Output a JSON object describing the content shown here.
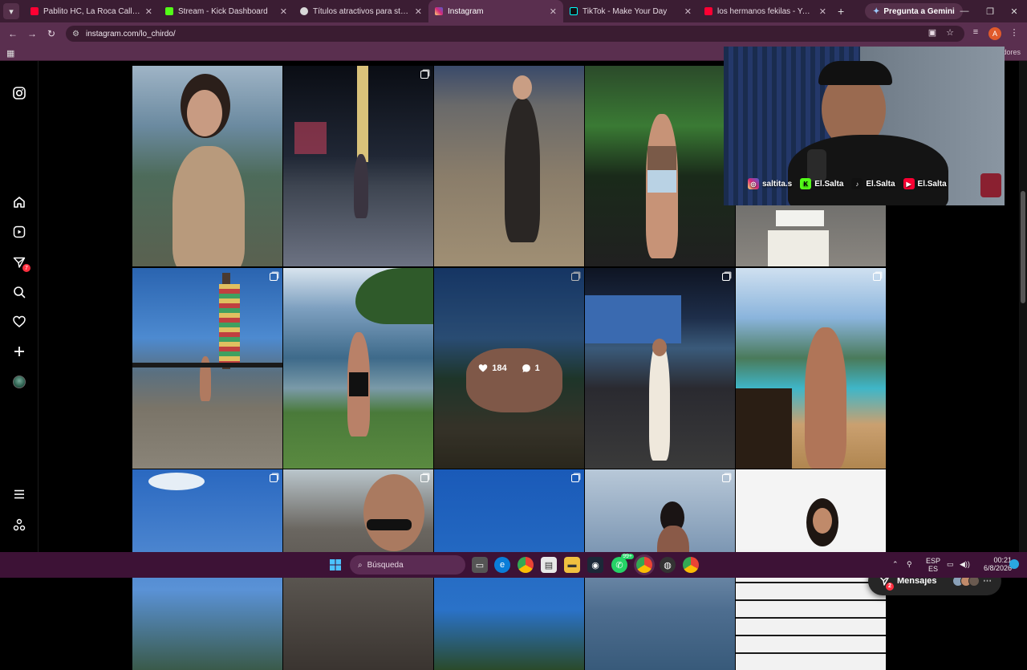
{
  "browser": {
    "tabs": [
      {
        "title": "Pablito HC, La Roca Callejera - ",
        "favicon_color": "#ff0033",
        "active": false
      },
      {
        "title": "Stream - Kick Dashboard",
        "favicon_color": "#53fc18",
        "active": false
      },
      {
        "title": "Títulos atractivos para stream",
        "favicon_color": "#d8d8d8",
        "active": false
      },
      {
        "title": "Instagram",
        "favicon_color": "#e1306c",
        "active": true
      },
      {
        "title": "TikTok - Make Your Day",
        "favicon_color": "#111111",
        "active": false
      },
      {
        "title": "los hermanos fekilas - YouTube",
        "favicon_color": "#ff0033",
        "active": false
      }
    ],
    "gemini_button": "Pregunta a Gemini",
    "url": "instagram.com/lo_chirdo/",
    "bookmarks_right": "dores",
    "profile_initial": "A"
  },
  "instagram": {
    "hovered_post": {
      "likes": "184",
      "comments": "1"
    },
    "messages_label": "Mensajes",
    "notification_count": "7",
    "messages_badge": "2"
  },
  "webcam": {
    "socials": [
      {
        "icon": "instagram-icon",
        "label": "saltita.s",
        "color": "#e1306c"
      },
      {
        "icon": "kick-icon",
        "label": "El.Salta",
        "color": "#53fc18"
      },
      {
        "icon": "tiktok-icon",
        "label": "El.Salta",
        "color": "#111111"
      },
      {
        "icon": "youtube-icon",
        "label": "El.Salta",
        "color": "#ff0033"
      }
    ]
  },
  "taskbar": {
    "search_placeholder": "Búsqueda",
    "lang": "ESP",
    "lang_sub": "ES",
    "time": "00:21",
    "date": "6/8/2026",
    "whatsapp_badge": "99+"
  }
}
